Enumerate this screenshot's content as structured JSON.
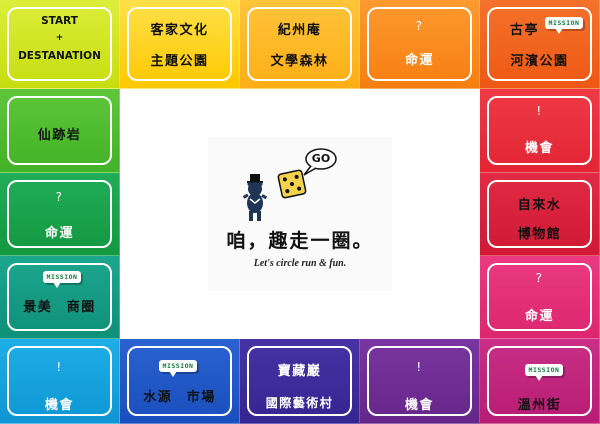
{
  "start_square": {
    "line1": "START",
    "line2": "+",
    "line3": "DESTANATION"
  },
  "top_row": [
    {
      "line1": "客家文化",
      "line2": "主題公園"
    },
    {
      "line1": "紀州庵",
      "line2": "文學森林"
    },
    {
      "line1": "?",
      "line2": "命運"
    },
    {
      "line1": "古亭",
      "line2": "河濱公園",
      "bubble": "MISSION"
    }
  ],
  "right_column": [
    {
      "line1": "!",
      "line2": "機會"
    },
    {
      "line1": "自來水",
      "line2": "博物館"
    },
    {
      "line1": "?",
      "line2": "命運"
    },
    {
      "line1": "溫州街",
      "bubble": "MISSION"
    }
  ],
  "bottom_row": [
    {
      "line1": "寶藏巖",
      "line2": "國際藝術村"
    },
    {
      "line1": "水源　市場",
      "bubble": "MISSION"
    },
    {
      "line1": "!",
      "line2": "機會"
    }
  ],
  "left_column": [
    {
      "line1": "仙跡岩"
    },
    {
      "line1": "?",
      "line2": "命運"
    },
    {
      "line1": "景美　商圈",
      "bubble": "MISSION"
    },
    {
      "line1": "!",
      "line2": "機會"
    }
  ],
  "center": {
    "go_bubble": "GO",
    "slogan_zh": "咱，趣走一圈。",
    "slogan_en": "Let's circle run & fun."
  },
  "colors": {
    "start": "#d3e820",
    "yellow": "#ffd21f",
    "orange": "#fb8c1c",
    "dark_orange": "#f26420",
    "red": "#e8303f",
    "crimson": "#d41f3c",
    "pink": "#e02d76",
    "magenta": "#c2237a",
    "purple": "#6d2c94",
    "indigo": "#3d2c9a",
    "blue": "#1c57c7",
    "mid_blue": "#1f6fd0",
    "sky": "#139fda",
    "teal": "#139b83",
    "green": "#18a34c",
    "lime_green": "#4cbb2c"
  }
}
